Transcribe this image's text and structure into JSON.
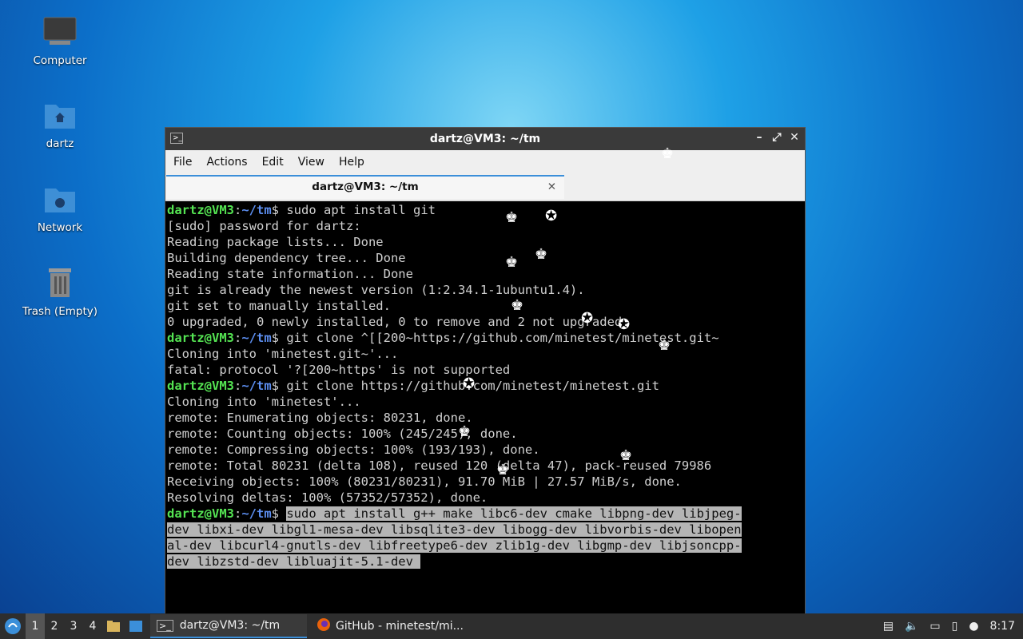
{
  "desktop": {
    "icons": [
      {
        "label": "Computer"
      },
      {
        "label": "dartz"
      },
      {
        "label": "Network"
      },
      {
        "label": "Trash (Empty)"
      }
    ]
  },
  "window": {
    "title": "dartz@VM3: ~/tm",
    "menu": [
      "File",
      "Actions",
      "Edit",
      "View",
      "Help"
    ],
    "tab_label": "dartz@VM3: ~/tm"
  },
  "terminal": {
    "user": "dartz@VM3",
    "path": "~/tm",
    "lines": [
      {
        "type": "cmd",
        "text": "sudo apt install git"
      },
      {
        "type": "out",
        "text": "[sudo] password for dartz:"
      },
      {
        "type": "out",
        "text": "Reading package lists... Done"
      },
      {
        "type": "out",
        "text": "Building dependency tree... Done"
      },
      {
        "type": "out",
        "text": "Reading state information... Done"
      },
      {
        "type": "out",
        "text": "git is already the newest version (1:2.34.1-1ubuntu1.4)."
      },
      {
        "type": "out",
        "text": "git set to manually installed."
      },
      {
        "type": "out",
        "text": "0 upgraded, 0 newly installed, 0 to remove and 2 not upgraded."
      },
      {
        "type": "cmd",
        "text": "git clone ^[[200~https://github.com/minetest/minetest.git~"
      },
      {
        "type": "out",
        "text": "Cloning into 'minetest.git~'..."
      },
      {
        "type": "out",
        "text": "fatal: protocol '?[200~https' is not supported"
      },
      {
        "type": "cmd",
        "text": "git clone https://github.com/minetest/minetest.git"
      },
      {
        "type": "out",
        "text": "Cloning into 'minetest'..."
      },
      {
        "type": "out",
        "text": "remote: Enumerating objects: 80231, done."
      },
      {
        "type": "out",
        "text": "remote: Counting objects: 100% (245/245), done."
      },
      {
        "type": "out",
        "text": "remote: Compressing objects: 100% (193/193), done."
      },
      {
        "type": "out",
        "text": "remote: Total 80231 (delta 108), reused 120 (delta 47), pack-reused 79986"
      },
      {
        "type": "out",
        "text": "Receiving objects: 100% (80231/80231), 91.70 MiB | 27.57 MiB/s, done."
      },
      {
        "type": "out",
        "text": "Resolving deltas: 100% (57352/57352), done."
      }
    ],
    "last_command": [
      "sudo apt install g++ make libc6-dev cmake libpng-dev libjpeg-",
      "dev libxi-dev libgl1-mesa-dev libsqlite3-dev libogg-dev libvorbis-dev libopen",
      "al-dev libcurl4-gnutls-dev libfreetype6-dev zlib1g-dev libgmp-dev libjsoncpp-",
      "dev libzstd-dev libluajit-5.1-dev "
    ]
  },
  "taskbar": {
    "workspaces": [
      "1",
      "2",
      "3",
      "4"
    ],
    "tasks": [
      {
        "label": "dartz@VM3: ~/tm"
      },
      {
        "label": "GitHub - minetest/mi..."
      }
    ],
    "clock": "8:17"
  }
}
